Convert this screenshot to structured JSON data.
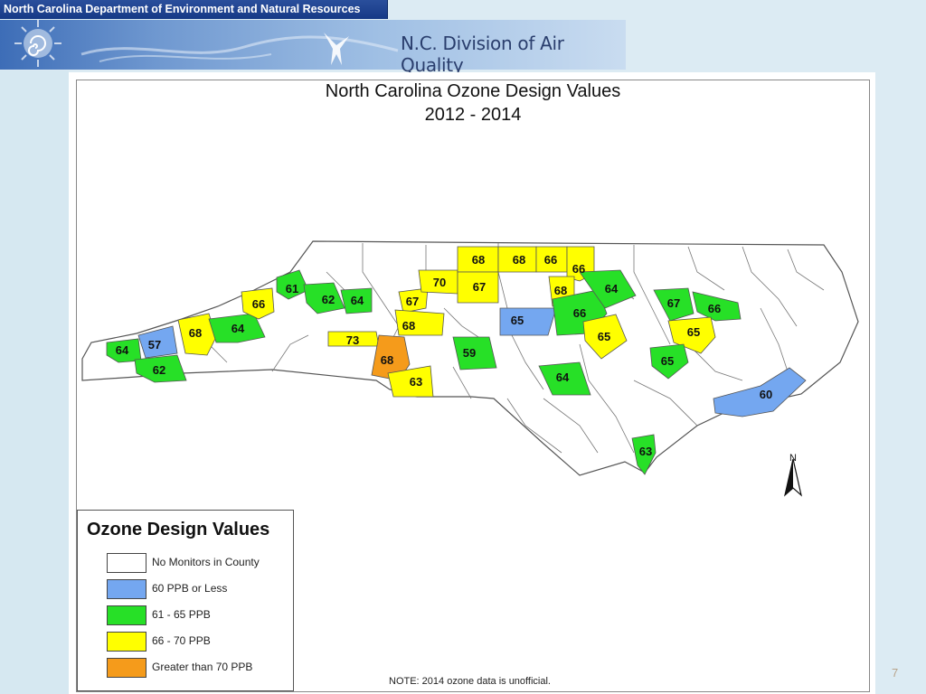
{
  "header": {
    "agency": "North Carolina Department of Environment and Natural Resources",
    "division": "N.C. Division of Air Quality"
  },
  "map": {
    "title_line1": "North Carolina Ozone Design Values",
    "title_line2": "2012 - 2014",
    "north_label": "N",
    "colors": {
      "none": "#ffffff",
      "le60": "#74a7f0",
      "r61_65": "#27e027",
      "r66_70": "#ffff00",
      "gt70": "#f59b1b"
    },
    "county_values": [
      "64",
      "57",
      "62",
      "68",
      "64",
      "66",
      "61",
      "62",
      "64",
      "67",
      "70",
      "68",
      "67",
      "68",
      "66",
      "66",
      "68",
      "68",
      "73",
      "68",
      "63",
      "59",
      "65",
      "66",
      "64",
      "65",
      "64",
      "67",
      "66",
      "65",
      "65",
      "60",
      "63"
    ]
  },
  "legend": {
    "title": "Ozone Design Values",
    "items": [
      {
        "label": "No Monitors in County",
        "color": "#ffffff"
      },
      {
        "label": "60 PPB or Less",
        "color": "#74a7f0"
      },
      {
        "label": "61 - 65 PPB",
        "color": "#27e027"
      },
      {
        "label": "66 - 70 PPB",
        "color": "#ffff00"
      },
      {
        "label": "Greater than 70 PPB",
        "color": "#f59b1b"
      }
    ]
  },
  "note": "NOTE: 2014 ozone data is unofficial.",
  "page_number": "7"
}
